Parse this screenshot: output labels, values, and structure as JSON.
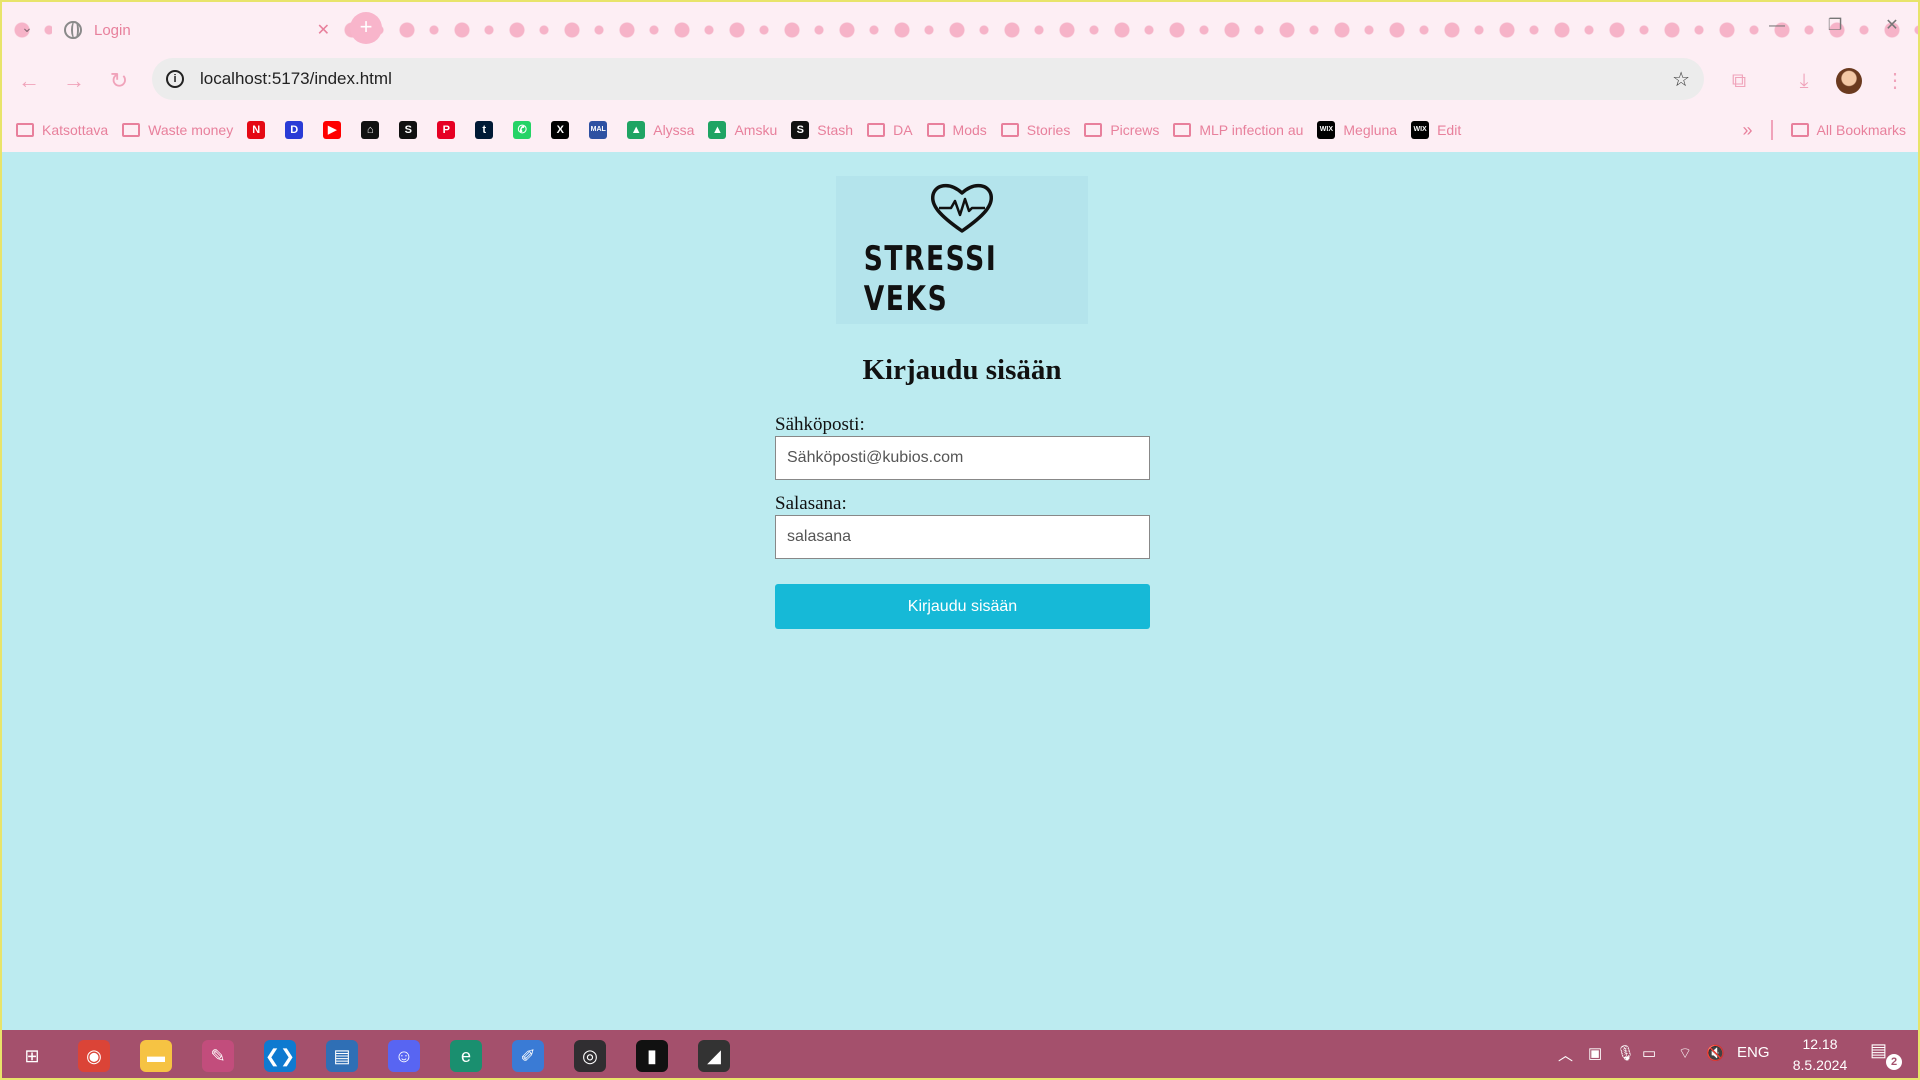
{
  "browser": {
    "tab": {
      "title": "Login",
      "close_glyph": "✕"
    },
    "url": "localhost:5173/index.html",
    "bookmarks": [
      {
        "label": "Katsottava",
        "icon": "folder-icon"
      },
      {
        "label": "Waste money",
        "icon": "folder-icon"
      },
      {
        "label": "",
        "icon": "netflix-icon",
        "glyph": "N",
        "color": "#e50914"
      },
      {
        "label": "",
        "icon": "disney-plus-icon",
        "glyph": "D",
        "color": "#2a3bd6"
      },
      {
        "label": "",
        "icon": "youtube-icon",
        "glyph": "▶",
        "color": "#ff0000"
      },
      {
        "label": "",
        "icon": "house-icon",
        "glyph": "⌂",
        "color": "#111111"
      },
      {
        "label": "",
        "icon": "stash-icon",
        "glyph": "S",
        "color": "#111111"
      },
      {
        "label": "",
        "icon": "pinterest-icon",
        "glyph": "P",
        "color": "#e60023"
      },
      {
        "label": "",
        "icon": "tumblr-icon",
        "glyph": "t",
        "color": "#001935"
      },
      {
        "label": "",
        "icon": "whatsapp-icon",
        "glyph": "✆",
        "color": "#25d366"
      },
      {
        "label": "",
        "icon": "x-icon",
        "glyph": "X",
        "color": "#000000"
      },
      {
        "label": "",
        "icon": "myanimelist-icon",
        "glyph": "MAL",
        "color": "#2e51a2"
      },
      {
        "label": "Alyssa",
        "icon": "google-drive-icon",
        "glyph": "▲",
        "color": "#1fa463"
      },
      {
        "label": "Amsku",
        "icon": "google-drive-icon",
        "glyph": "▲",
        "color": "#1fa463"
      },
      {
        "label": "Stash",
        "icon": "stash-icon",
        "glyph": "S",
        "color": "#111111"
      },
      {
        "label": "DA",
        "icon": "folder-icon"
      },
      {
        "label": "Mods",
        "icon": "folder-icon"
      },
      {
        "label": "Stories",
        "icon": "folder-icon"
      },
      {
        "label": "Picrews",
        "icon": "folder-icon"
      },
      {
        "label": "MLP infection au",
        "icon": "folder-icon"
      },
      {
        "label": "Megluna",
        "icon": "wix-icon",
        "glyph": "WIX",
        "color": "#000000"
      },
      {
        "label": "Edit",
        "icon": "wix-icon",
        "glyph": "WIX",
        "color": "#000000"
      }
    ],
    "more_bookmarks_glyph": "»",
    "all_bookmarks": "All Bookmarks"
  },
  "page": {
    "logo_text": "STRESSI VEKS",
    "title": "Kirjaudu sisään",
    "email_label": "Sähköposti:",
    "email_placeholder": "Sähköposti@kubios.com",
    "password_label": "Salasana:",
    "password_placeholder": "salasana",
    "submit_label": "Kirjaudu sisään"
  },
  "taskbar": {
    "apps": [
      {
        "name": "windows-start-icon",
        "glyph": "⊞",
        "color": "transparent"
      },
      {
        "name": "chrome-icon",
        "glyph": "◉",
        "color": "#db4437"
      },
      {
        "name": "file-explorer-icon",
        "glyph": "▬",
        "color": "#f6c343"
      },
      {
        "name": "paint-app-icon",
        "glyph": "✎",
        "color": "#c24d7c"
      },
      {
        "name": "vscode-icon",
        "glyph": "❮❯",
        "color": "#0e7ad0"
      },
      {
        "name": "notepad-icon",
        "glyph": "▤",
        "color": "#2f6fb5"
      },
      {
        "name": "discord-icon",
        "glyph": "☺",
        "color": "#5865f2"
      },
      {
        "name": "edge-icon",
        "glyph": "e",
        "color": "#1a8f6f"
      },
      {
        "name": "krita-icon",
        "glyph": "✐",
        "color": "#3a7bd5"
      },
      {
        "name": "obs-icon",
        "glyph": "◎",
        "color": "#302e31"
      },
      {
        "name": "terminal-icon",
        "glyph": "▮",
        "color": "#111111"
      },
      {
        "name": "nvidia-icon",
        "glyph": "◢",
        "color": "#333333"
      }
    ],
    "language": "ENG",
    "time": "12.18",
    "date": "8.5.2024",
    "notification_count": "2"
  },
  "colors": {
    "page_background": "#bcebf0",
    "button_primary": "#16b9d7",
    "chrome_accent": "#e8809c",
    "taskbar": "#a4506c"
  }
}
